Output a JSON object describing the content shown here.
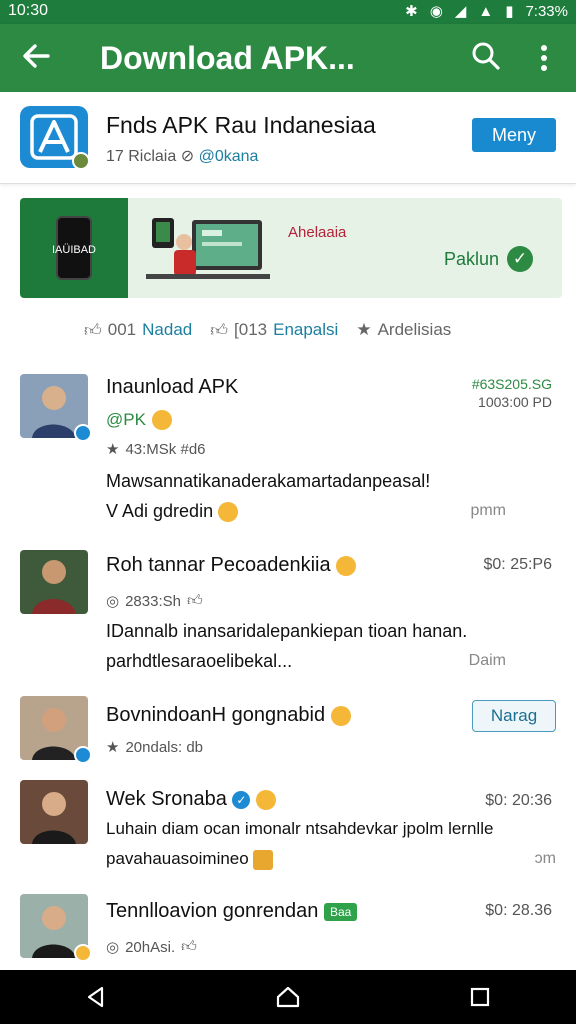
{
  "status": {
    "time": "10:30",
    "right_time": "7:33%"
  },
  "appbar": {
    "title": "Download  APK..."
  },
  "app": {
    "name": "Fnds APK  Rau Indanesiaa",
    "sub_count": "17 Riclaia",
    "sub_tag": "@0kana",
    "menu_label": "Meny"
  },
  "banner": {
    "phone_text": "IAÜIBAD",
    "headline": "Ahelaaia",
    "cta": "Paklun"
  },
  "stats": [
    {
      "count": "001",
      "label": "Nadad"
    },
    {
      "count": "[013",
      "label": "Enapalsi"
    },
    {
      "count": "",
      "label": "Ardelisias"
    }
  ],
  "posts": [
    {
      "title": "Inaunload APK",
      "tag": "@PK",
      "meta": "43:MSk #d6",
      "body_line1": "Mawsannatikanaderakamartadanpeasal!",
      "body_line2": "V Adi gdredin",
      "price": "#63S205.SG",
      "time": "1003:00 PD",
      "foot": "pmm"
    },
    {
      "title": "Roh tannar Pecoadenkiia",
      "meta": "2833:Sh",
      "body_line1": "IDannalb inansaridalepankiepan tioan hanan.",
      "body_line2": "parhdtlesaraoelibekal...",
      "time": "$0: 25:P6",
      "foot": "Daim"
    },
    {
      "title": "BovnindoanH gongnabid",
      "meta": "20ndals: db",
      "button": "Narag"
    },
    {
      "title": "Wek Sronaba",
      "body_line1": "Luhain diam ocan imonalr ntsahdevkar jpolm lernlle",
      "body_line2": "pavahauasoimineo",
      "time": "$0: 20:36",
      "foot": "ɔm"
    },
    {
      "title": "Tennlloavion gonrendan",
      "chip": "Baa",
      "meta": "20hAsi.",
      "time": "$0: 28.36"
    }
  ],
  "colors": {
    "primary": "#2c8a43",
    "status": "#1e7d3c",
    "accent_blue": "#1a8ad0"
  }
}
